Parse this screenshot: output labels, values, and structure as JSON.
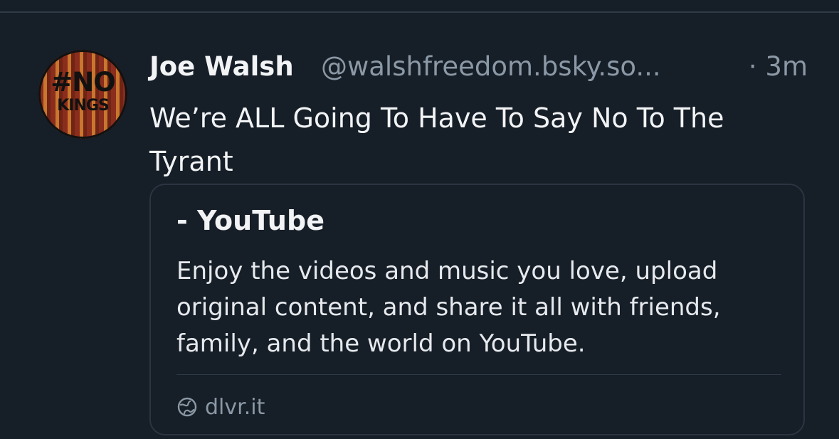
{
  "post": {
    "author_name": "Joe Walsh",
    "author_handle": "@walshfreedom.bsky.so...",
    "timestamp": "· 3m",
    "avatar_text_line1": "#NO",
    "avatar_text_line2": "KINGS",
    "text": "We’re ALL Going To Have To Say No To The Tyrant"
  },
  "link_card": {
    "title": "- YouTube",
    "description": "Enjoy the videos and music you love, upload original content, and share it all with friends, family, and the world on YouTube.",
    "domain": "dlvr.it",
    "domain_icon": "globe-icon"
  },
  "colors": {
    "background": "#161e27",
    "primary_text": "#f1f3f5",
    "secondary_text": "#8b98a6",
    "border": "#2a3541"
  }
}
